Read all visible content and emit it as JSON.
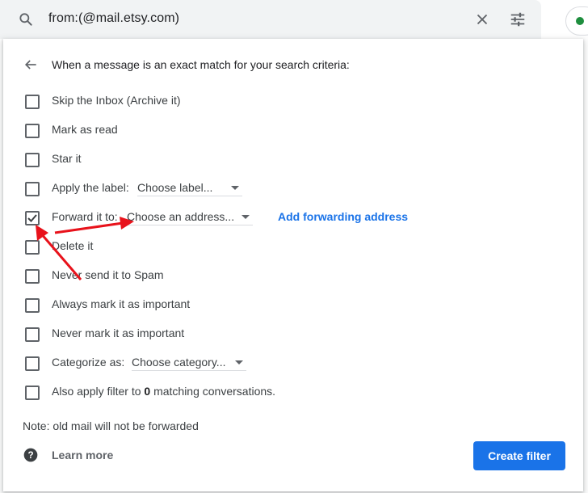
{
  "search": {
    "query": "from:(@mail.etsy.com)",
    "icons": {
      "search": "search-icon",
      "clear": "close-icon",
      "options": "tune-icon"
    }
  },
  "status": {
    "color": "#1e8e3e"
  },
  "panel": {
    "header": "When a message is an exact match for your search criteria:",
    "options": [
      {
        "label": "Skip the Inbox (Archive it)",
        "checked": false
      },
      {
        "label": "Mark as read",
        "checked": false
      },
      {
        "label": "Star it",
        "checked": false
      },
      {
        "label": "Apply the label:",
        "checked": false,
        "dropdown": "Choose label..."
      },
      {
        "label": "Forward it to:",
        "checked": true,
        "dropdown": "Choose an address...",
        "link": "Add forwarding address"
      },
      {
        "label": "Delete it",
        "checked": false
      },
      {
        "label": "Never send it to Spam",
        "checked": false
      },
      {
        "label": "Always mark it as important",
        "checked": false
      },
      {
        "label": "Never mark it as important",
        "checked": false
      },
      {
        "label": "Categorize as:",
        "checked": false,
        "dropdown": "Choose category..."
      },
      {
        "label_prefix": "Also apply filter to ",
        "count": "0",
        "label_suffix": " matching conversations.",
        "checked": false
      }
    ],
    "note": "Note: old mail will not be forwarded",
    "learn_more": "Learn more",
    "create_button": "Create filter"
  },
  "colors": {
    "accent": "#1a73e8",
    "annotation": "#e8121b"
  }
}
